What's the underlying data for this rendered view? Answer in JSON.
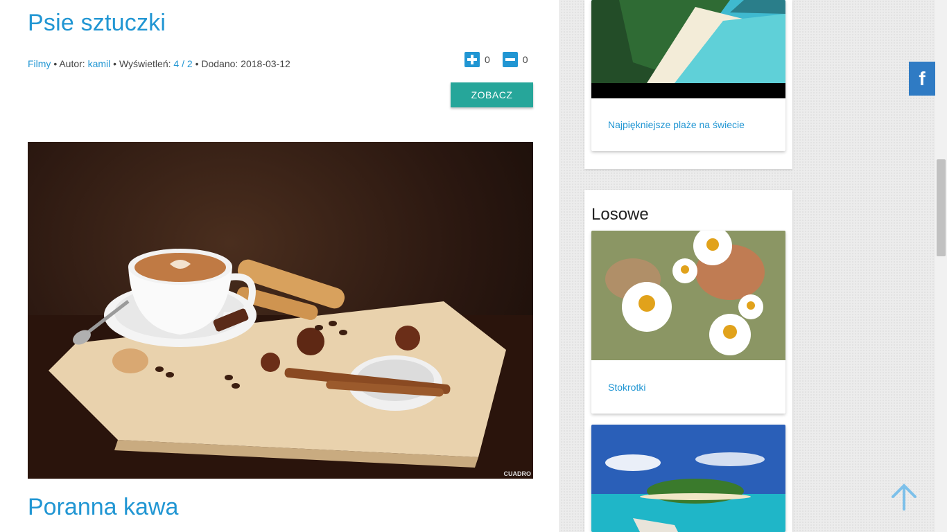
{
  "post": {
    "title": "Psie sztuczki",
    "category": "Filmy",
    "author_label": "• Autor:",
    "author": "kamil",
    "views_label": "• Wyświetleń:",
    "views_a": "4",
    "views_sep": "/",
    "views_b": "2",
    "added": "• Dodano: 2018-03-12",
    "upvotes": "0",
    "downvotes": "0",
    "button": "ZOBACZ"
  },
  "post2": {
    "title": "Poranna kawa",
    "image_watermark": "CUADRO"
  },
  "sidebar": {
    "top_card": {
      "link": "Najpiękniejsze plaże na świecie"
    },
    "random_widget": {
      "title": "Losowe",
      "cards": [
        {
          "link": "Stokrotki"
        }
      ]
    }
  },
  "social": {
    "facebook": "f"
  },
  "colors": {
    "link": "#2196d3",
    "button": "#26a69a",
    "facebook": "#2f7bc4"
  }
}
